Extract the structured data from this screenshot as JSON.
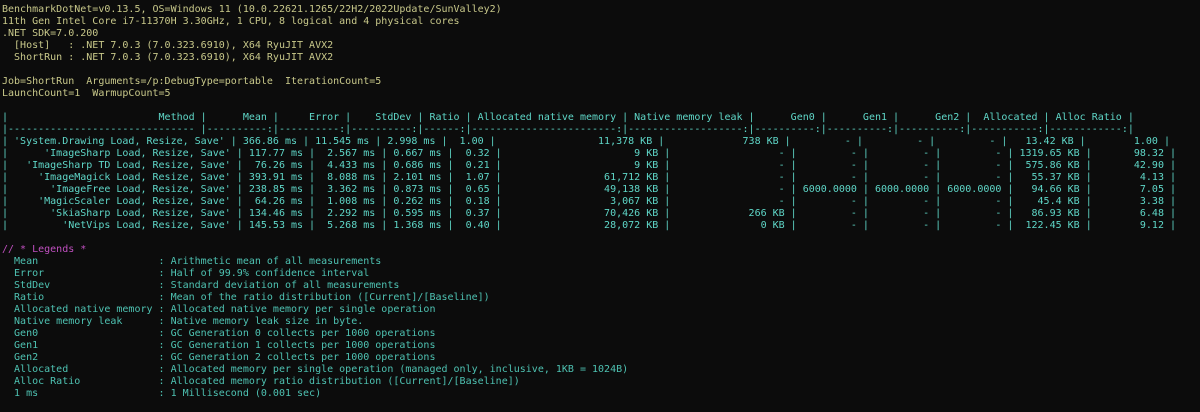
{
  "env": {
    "line1": "BenchmarkDotNet=v0.13.5, OS=Windows 11 (10.0.22621.1265/22H2/2022Update/SunValley2)",
    "line2": "11th Gen Intel Core i7-11370H 3.30GHz, 1 CPU, 8 logical and 4 physical cores",
    "line3": ".NET SDK=7.0.200",
    "line4": "  [Host]   : .NET 7.0.3 (7.0.323.6910), X64 RyuJIT AVX2",
    "line5": "  ShortRun : .NET 7.0.3 (7.0.323.6910), X64 RyuJIT AVX2",
    "line6": "Job=ShortRun  Arguments=/p:DebugType=portable  IterationCount=5",
    "line7": "LaunchCount=1  WarmupCount=5"
  },
  "table": {
    "header": "|                         Method |      Mean |     Error |    StdDev | Ratio | Allocated native memory | Native memory leak |      Gen0 |      Gen1 |      Gen2 |  Allocated | Alloc Ratio |",
    "separator": "|------------------------------- |----------:|----------:|----------:|------:|------------------------:|-------------------:|----------:|----------:|----------:|-----------:|------------:|",
    "rows": [
      "| 'System.Drawing Load, Resize, Save' | 366.86 ms | 11.545 ms | 2.998 ms |  1.00 |                 11,378 KB |             738 KB |         - |         - |         - |   13.42 KB |        1.00 |",
      "|      'ImageSharp Load, Resize, Save' | 117.77 ms |  2.567 ms | 0.667 ms |  0.32 |                      9 KB |                  - |         - |         - |         - | 1319.65 KB |       98.32 |",
      "|   'ImageSharp TD Load, Resize, Save' |  76.26 ms |  4.433 ms | 0.686 ms |  0.21 |                      9 KB |                  - |         - |         - |         - |  575.86 KB |       42.90 |",
      "|     'ImageMagick Load, Resize, Save' | 393.91 ms |  8.088 ms | 2.101 ms |  1.07 |                 61,712 KB |                  - |         - |         - |         - |   55.37 KB |        4.13 |",
      "|       'ImageFree Load, Resize, Save' | 238.85 ms |  3.362 ms | 0.873 ms |  0.65 |                 49,138 KB |                  - | 6000.0000 | 6000.0000 | 6000.0000 |   94.66 KB |        7.05 |",
      "|     'MagicScaler Load, Resize, Save' |  64.26 ms |  1.008 ms | 0.262 ms |  0.18 |                  3,067 KB |                  - |         - |         - |         - |    45.4 KB |        3.38 |",
      "|       'SkiaSharp Load, Resize, Save' | 134.46 ms |  2.292 ms | 0.595 ms |  0.37 |                 70,426 KB |             266 KB |         - |         - |         - |   86.93 KB |        6.48 |",
      "|         'NetVips Load, Resize, Save' | 145.53 ms |  5.268 ms | 1.368 ms |  0.40 |                 28,072 KB |               0 KB |         - |         - |         - |  122.45 KB |        9.12 |"
    ]
  },
  "legends": {
    "title": "// * Legends *",
    "items": [
      "  Mean                    : Arithmetic mean of all measurements",
      "  Error                   : Half of 99.9% confidence interval",
      "  StdDev                  : Standard deviation of all measurements",
      "  Ratio                   : Mean of the ratio distribution ([Current]/[Baseline])",
      "  Allocated native memory : Allocated native memory per single operation",
      "  Native memory leak      : Native memory leak size in byte.",
      "  Gen0                    : GC Generation 0 collects per 1000 operations",
      "  Gen1                    : GC Generation 1 collects per 1000 operations",
      "  Gen2                    : GC Generation 2 collects per 1000 operations",
      "  Allocated               : Allocated memory per single operation (managed only, inclusive, 1KB = 1024B)",
      "  Alloc Ratio             : Allocated memory ratio distribution ([Current]/[Baseline])",
      "  1 ms                    : 1 Millisecond (0.001 sec)"
    ]
  }
}
